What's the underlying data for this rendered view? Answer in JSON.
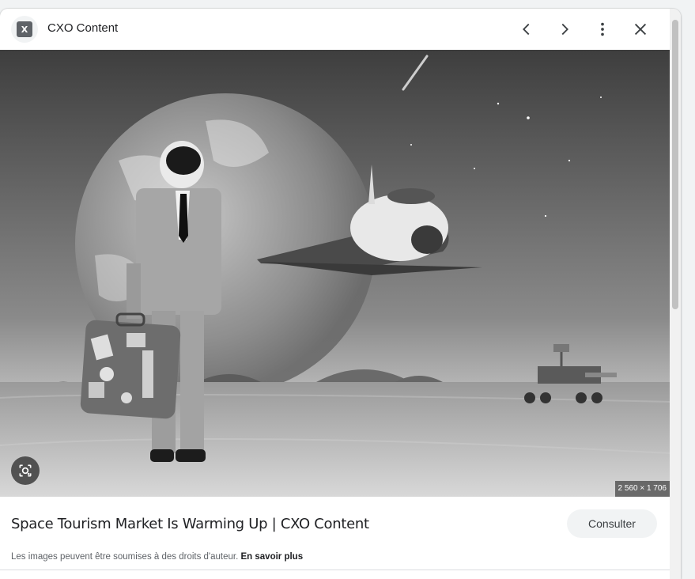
{
  "header": {
    "site_logo_text": "X",
    "site_name": "CXO Content",
    "prev_icon": "chevron-left-icon",
    "next_icon": "chevron-right-icon",
    "more_icon": "more-vert-icon",
    "close_icon": "close-icon"
  },
  "image": {
    "dimensions": "2 560 × 1 706",
    "lens_icon": "lens-icon"
  },
  "details": {
    "title": "Space Tourism Market Is Warming Up | CXO Content",
    "visit_label": "Consulter",
    "copyright_text": "Les images peuvent être soumises à des droits d'auteur.",
    "learn_more": "En savoir plus"
  }
}
